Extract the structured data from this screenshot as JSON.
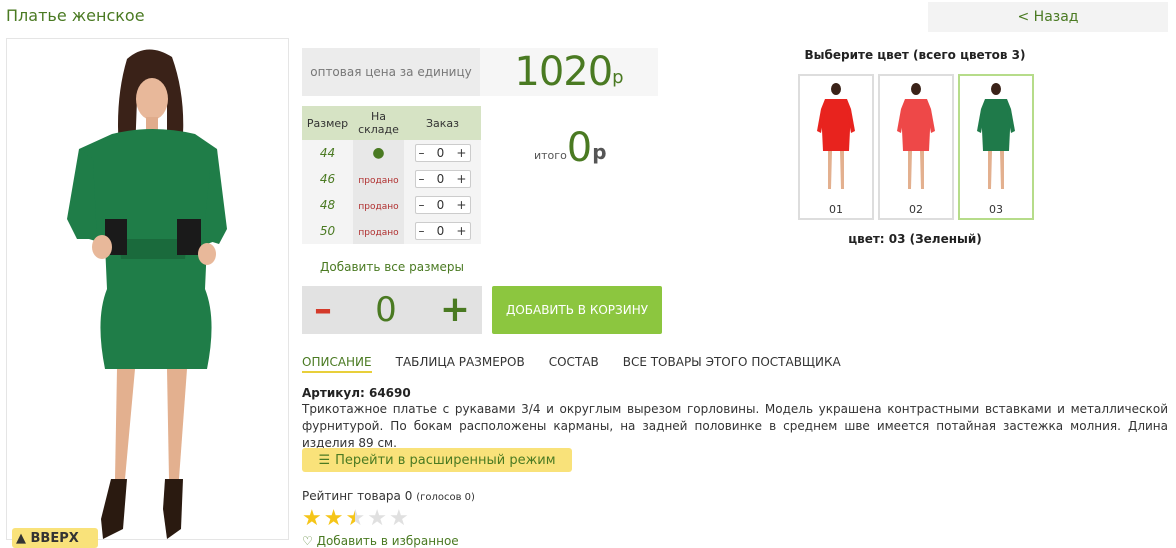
{
  "page": {
    "title": "Платье женское",
    "back_label": "< Назад",
    "up_label": "▲ ВВЕРХ"
  },
  "price": {
    "label": "оптовая цена за единицу",
    "value": "1020",
    "currency": "р"
  },
  "size_table": {
    "headers": [
      "Размер",
      "На складе",
      "Заказ"
    ],
    "rows": [
      {
        "size": "44",
        "stock": "●",
        "qty": "0"
      },
      {
        "size": "46",
        "stock": "продано",
        "qty": "0"
      },
      {
        "size": "48",
        "stock": "продано",
        "qty": "0"
      },
      {
        "size": "50",
        "stock": "продано",
        "qty": "0"
      }
    ]
  },
  "total": {
    "label": "итого",
    "value": "0",
    "currency": "р"
  },
  "add_all_label": "Добавить все размеры",
  "bulk": {
    "minus": "–",
    "qty": "0",
    "plus": "+"
  },
  "cart_label": "ДОБАВИТЬ В КОРЗИНУ",
  "tabs": [
    "ОПИСАНИЕ",
    "ТАБЛИЦА РАЗМЕРОВ",
    "СОСТАВ",
    "ВСЕ ТОВАРЫ ЭТОГО ПОСТАВЩИКА"
  ],
  "article": "Артикул: 64690",
  "description": "Трикотажное платье с рукавами 3/4 и округлым вырезом горловины. Модель украшена контрастными вставками и металлической фурнитурой. По бокам расположены карманы, на задней половинке в среднем шве имеется потайная застежка молния. Длина изделия 89 см.",
  "extended_mode_label": "Перейти в расширенный режим",
  "rating": {
    "label": "Рейтинг товара 0",
    "votes": "(голосов 0)",
    "stars_filled": 2.5,
    "stars_total": 5
  },
  "favorites_label": "Добавить в избранное",
  "colors": {
    "header": "Выберите цвет (всего цветов 3)",
    "items": [
      {
        "code": "01",
        "color": "#e8231e"
      },
      {
        "code": "02",
        "color": "#ee4848"
      },
      {
        "code": "03",
        "color": "#1f7a4a"
      }
    ],
    "selected_label": "цвет: 03 (Зеленый)"
  }
}
